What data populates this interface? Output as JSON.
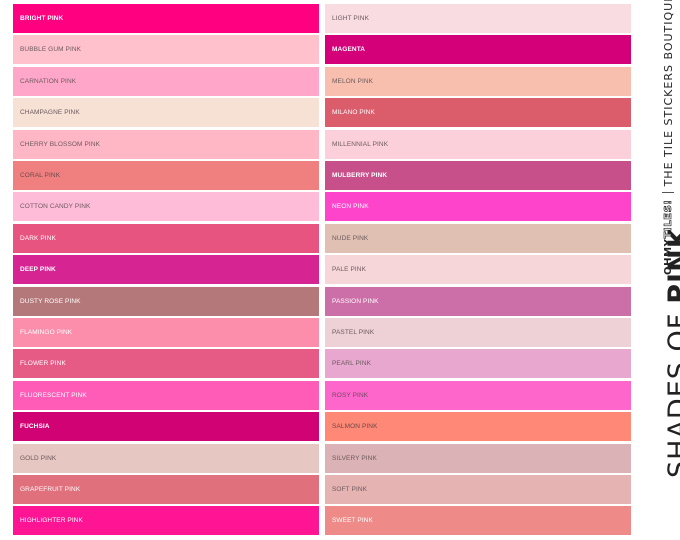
{
  "left_swatches": [
    {
      "name": "BRIGHT PINK",
      "color": "#FF0080",
      "text": "#FFFFFF",
      "bold": true
    },
    {
      "name": "BUBBLE GUM PINK",
      "color": "#FFC1CC",
      "text": "#6B5A5E",
      "bold": false
    },
    {
      "name": "CARNATION PINK",
      "color": "#FFA6C9",
      "text": "#6B5A5E",
      "bold": false
    },
    {
      "name": "CHAMPAGNE PINK",
      "color": "#F7E1D5",
      "text": "#6B5A5E",
      "bold": false
    },
    {
      "name": "CHERRY BLOSSOM PINK",
      "color": "#FFB7C5",
      "text": "#6B5A5E",
      "bold": false
    },
    {
      "name": "CORAL PINK",
      "color": "#F08080",
      "text": "#6B4A4A",
      "bold": false
    },
    {
      "name": "COTTON CANDY PINK",
      "color": "#FFBCD9",
      "text": "#6B5A5E",
      "bold": false
    },
    {
      "name": "DARK PINK",
      "color": "#E75480",
      "text": "#FFFFFF",
      "bold": false
    },
    {
      "name": "DEEP PINK",
      "color": "#D62492",
      "text": "#FFFFFF",
      "bold": true
    },
    {
      "name": "DUSTY ROSE PINK",
      "color": "#B5787A",
      "text": "#FFFFFF",
      "bold": false
    },
    {
      "name": "FLAMINGO PINK",
      "color": "#FC8EAC",
      "text": "#FFFFFF",
      "bold": false
    },
    {
      "name": "FLOWER PINK",
      "color": "#E65A86",
      "text": "#FFFFFF",
      "bold": false
    },
    {
      "name": "FLUORESCENT PINK",
      "color": "#FF5CB8",
      "text": "#FFFFFF",
      "bold": false
    },
    {
      "name": "FUCHSIA",
      "color": "#D10374",
      "text": "#FFFFFF",
      "bold": true
    },
    {
      "name": "GOLD PINK",
      "color": "#E6C7C2",
      "text": "#6B5A5E",
      "bold": false
    },
    {
      "name": "GRAPEFRUIT PINK",
      "color": "#E0707C",
      "text": "#FFFFFF",
      "bold": false
    },
    {
      "name": "HIGHLIGHTER PINK",
      "color": "#FF1493",
      "text": "#FFFFFF",
      "bold": false
    }
  ],
  "right_swatches": [
    {
      "name": "LIGHT PINK",
      "color": "#F9DCE2",
      "text": "#6B5A5E",
      "bold": false
    },
    {
      "name": "MAGENTA",
      "color": "#D4007A",
      "text": "#FFFFFF",
      "bold": true
    },
    {
      "name": "MELON PINK",
      "color": "#F9BFAE",
      "text": "#6B5A5E",
      "bold": false
    },
    {
      "name": "MILANO PINK",
      "color": "#DB5C6B",
      "text": "#FFFFFF",
      "bold": false
    },
    {
      "name": "MILLENNIAL PINK",
      "color": "#FCD0DA",
      "text": "#6B5A5E",
      "bold": false
    },
    {
      "name": "MULBERRY PINK",
      "color": "#C8508A",
      "text": "#FFFFFF",
      "bold": true
    },
    {
      "name": "NEON PINK",
      "color": "#FF44CC",
      "text": "#FFFFFF",
      "bold": false
    },
    {
      "name": "NUDE PINK",
      "color": "#E0C0B2",
      "text": "#6B5A5E",
      "bold": false
    },
    {
      "name": "PALE PINK",
      "color": "#F7D6DA",
      "text": "#6B5A5E",
      "bold": false
    },
    {
      "name": "PASSION PINK",
      "color": "#CC6FA8",
      "text": "#FFFFFF",
      "bold": false
    },
    {
      "name": "PASTEL PINK",
      "color": "#EED1D6",
      "text": "#6B5A5E",
      "bold": false
    },
    {
      "name": "PEARL PINK",
      "color": "#E7A7CF",
      "text": "#6B5A5E",
      "bold": false
    },
    {
      "name": "ROSY PINK",
      "color": "#FF66CC",
      "text": "#6B4A5E",
      "bold": false
    },
    {
      "name": "SALMON PINK",
      "color": "#FF8877",
      "text": "#6B4A4A",
      "bold": false
    },
    {
      "name": "SILVERY PINK",
      "color": "#DBB2B5",
      "text": "#6B5A5E",
      "bold": false
    },
    {
      "name": "SOFT PINK",
      "color": "#E6B3B3",
      "text": "#6B5A5E",
      "bold": false
    },
    {
      "name": "SWEET PINK",
      "color": "#EE8B88",
      "text": "#FFFFFF",
      "bold": false
    }
  ],
  "sidebar": {
    "title_light": "SHADES OF",
    "title_bold": "PINK",
    "logo_prefix": "OHMY",
    "logo_suffix": "TILES!",
    "boutique": "THE TILE STICKERS BOUTIQUE"
  }
}
